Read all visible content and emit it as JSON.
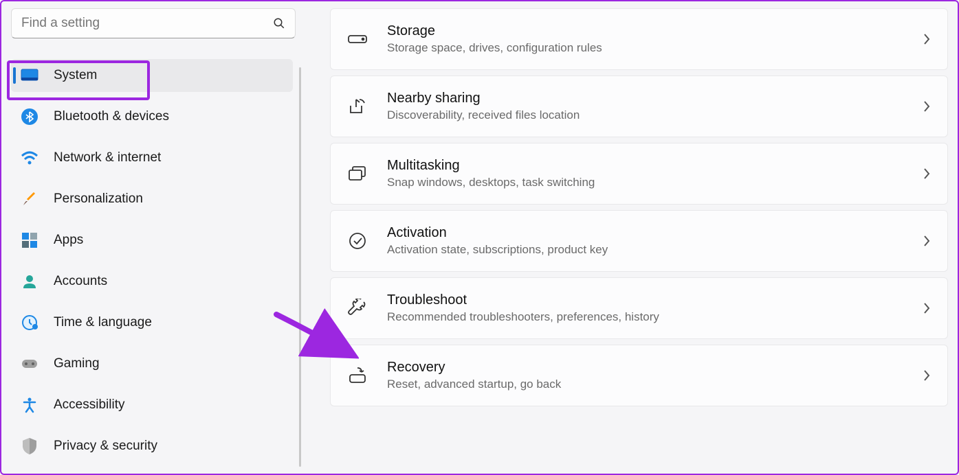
{
  "search": {
    "placeholder": "Find a setting"
  },
  "sidebar": {
    "items": [
      {
        "label": "System",
        "icon": "monitor",
        "active": true
      },
      {
        "label": "Bluetooth & devices",
        "icon": "bluetooth",
        "active": false
      },
      {
        "label": "Network & internet",
        "icon": "wifi",
        "active": false
      },
      {
        "label": "Personalization",
        "icon": "brush",
        "active": false
      },
      {
        "label": "Apps",
        "icon": "grid",
        "active": false
      },
      {
        "label": "Accounts",
        "icon": "person",
        "active": false
      },
      {
        "label": "Time & language",
        "icon": "clock",
        "active": false
      },
      {
        "label": "Gaming",
        "icon": "gamepad",
        "active": false
      },
      {
        "label": "Accessibility",
        "icon": "access",
        "active": false
      },
      {
        "label": "Privacy & security",
        "icon": "shield",
        "active": false
      }
    ]
  },
  "main": {
    "items": [
      {
        "title": "Storage",
        "sub": "Storage space, drives, configuration rules",
        "icon": "storage"
      },
      {
        "title": "Nearby sharing",
        "sub": "Discoverability, received files location",
        "icon": "share"
      },
      {
        "title": "Multitasking",
        "sub": "Snap windows, desktops, task switching",
        "icon": "stack"
      },
      {
        "title": "Activation",
        "sub": "Activation state, subscriptions, product key",
        "icon": "check"
      },
      {
        "title": "Troubleshoot",
        "sub": "Recommended troubleshooters, preferences, history",
        "icon": "wrench"
      },
      {
        "title": "Recovery",
        "sub": "Reset, advanced startup, go back",
        "icon": "recover"
      }
    ]
  }
}
